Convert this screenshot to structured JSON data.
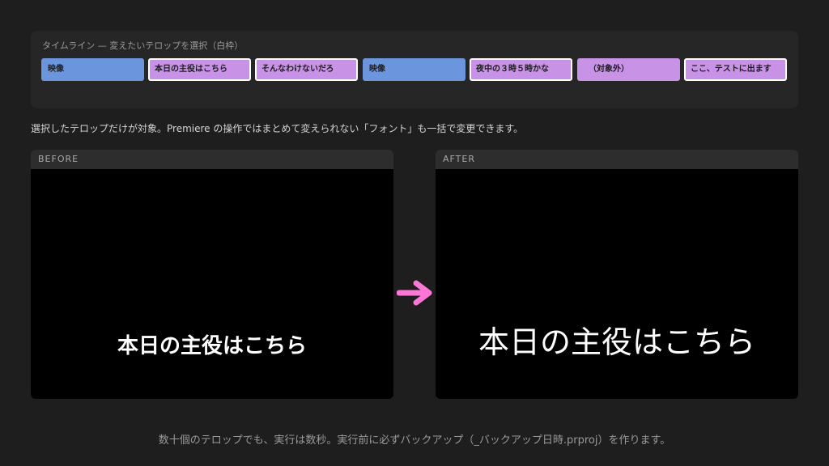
{
  "timeline": {
    "label": "タイムライン — 変えたいテロップを選択（白枠）",
    "clips": [
      {
        "label": "映像",
        "kind": "video"
      },
      {
        "label": "本日の主役はこちら",
        "kind": "telop-selected"
      },
      {
        "label": "そんなわけないだろ",
        "kind": "telop-selected"
      },
      {
        "label": "映像",
        "kind": "video"
      },
      {
        "label": "夜中の３時５時かな",
        "kind": "telop-selected"
      },
      {
        "label": "（対象外）",
        "kind": "telop-excluded"
      },
      {
        "label": "ここ、テストに出ます",
        "kind": "telop-selected"
      }
    ]
  },
  "caption": "選択したテロップだけが対象。Premiere の操作ではまとめて変えられない「フォント」も一括で変更できます。",
  "preview": {
    "before_label": "BEFORE",
    "after_label": "AFTER",
    "before_text": "本日の主役はこちら",
    "after_text": "本日の主役はこちら",
    "arrow_icon": "arrow-right-icon"
  },
  "footer": "数十個のテロップでも、実行は数秒。実行前に必ずバックアップ（_バックアップ日時.prproj）を作ります。",
  "colors": {
    "video_clip": "#6b95dd",
    "telop_clip": "#c892e6",
    "selection_border": "#ffffff",
    "arrow": "#ff77d6"
  }
}
